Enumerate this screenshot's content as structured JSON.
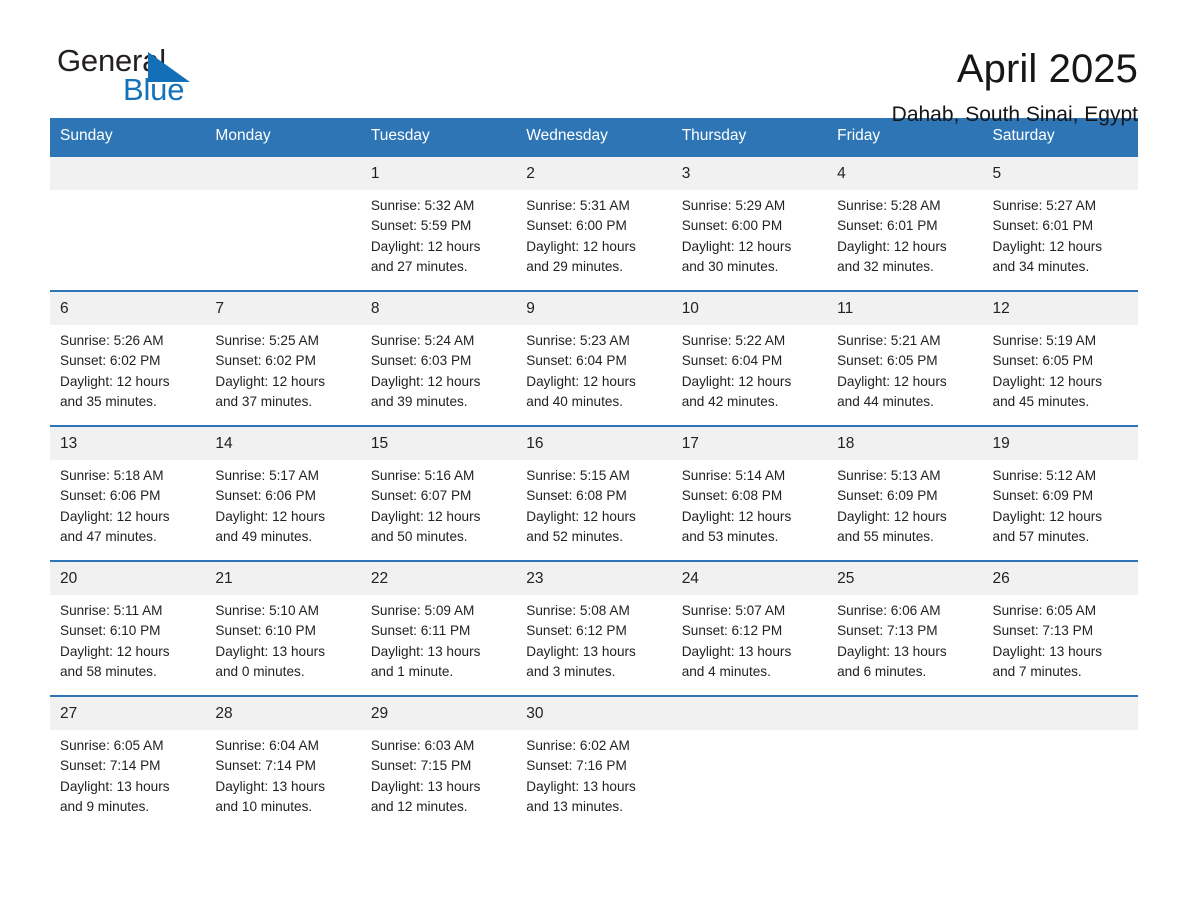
{
  "logo": {
    "word_top": "General",
    "word_bottom": "Blue",
    "triangle_icon": "triangle-icon"
  },
  "header": {
    "month_title": "April 2025",
    "location": "Dahab, South Sinai, Egypt"
  },
  "colors": {
    "brand_blue": "#2e75b6",
    "logo_blue": "#1571b8",
    "daynum_band": "#f1f1f1",
    "text": "#222222"
  },
  "calendar": {
    "weekday_headers": [
      "Sunday",
      "Monday",
      "Tuesday",
      "Wednesday",
      "Thursday",
      "Friday",
      "Saturday"
    ],
    "labels": {
      "sunrise": "Sunrise:",
      "sunset": "Sunset:",
      "daylight": "Daylight:"
    },
    "weeks": [
      [
        {
          "day": "",
          "empty": true
        },
        {
          "day": "",
          "empty": true
        },
        {
          "day": "1",
          "sunrise": "Sunrise: 5:32 AM",
          "sunset": "Sunset: 5:59 PM",
          "daylight_1": "Daylight: 12 hours",
          "daylight_2": "and 27 minutes."
        },
        {
          "day": "2",
          "sunrise": "Sunrise: 5:31 AM",
          "sunset": "Sunset: 6:00 PM",
          "daylight_1": "Daylight: 12 hours",
          "daylight_2": "and 29 minutes."
        },
        {
          "day": "3",
          "sunrise": "Sunrise: 5:29 AM",
          "sunset": "Sunset: 6:00 PM",
          "daylight_1": "Daylight: 12 hours",
          "daylight_2": "and 30 minutes."
        },
        {
          "day": "4",
          "sunrise": "Sunrise: 5:28 AM",
          "sunset": "Sunset: 6:01 PM",
          "daylight_1": "Daylight: 12 hours",
          "daylight_2": "and 32 minutes."
        },
        {
          "day": "5",
          "sunrise": "Sunrise: 5:27 AM",
          "sunset": "Sunset: 6:01 PM",
          "daylight_1": "Daylight: 12 hours",
          "daylight_2": "and 34 minutes."
        }
      ],
      [
        {
          "day": "6",
          "sunrise": "Sunrise: 5:26 AM",
          "sunset": "Sunset: 6:02 PM",
          "daylight_1": "Daylight: 12 hours",
          "daylight_2": "and 35 minutes."
        },
        {
          "day": "7",
          "sunrise": "Sunrise: 5:25 AM",
          "sunset": "Sunset: 6:02 PM",
          "daylight_1": "Daylight: 12 hours",
          "daylight_2": "and 37 minutes."
        },
        {
          "day": "8",
          "sunrise": "Sunrise: 5:24 AM",
          "sunset": "Sunset: 6:03 PM",
          "daylight_1": "Daylight: 12 hours",
          "daylight_2": "and 39 minutes."
        },
        {
          "day": "9",
          "sunrise": "Sunrise: 5:23 AM",
          "sunset": "Sunset: 6:04 PM",
          "daylight_1": "Daylight: 12 hours",
          "daylight_2": "and 40 minutes."
        },
        {
          "day": "10",
          "sunrise": "Sunrise: 5:22 AM",
          "sunset": "Sunset: 6:04 PM",
          "daylight_1": "Daylight: 12 hours",
          "daylight_2": "and 42 minutes."
        },
        {
          "day": "11",
          "sunrise": "Sunrise: 5:21 AM",
          "sunset": "Sunset: 6:05 PM",
          "daylight_1": "Daylight: 12 hours",
          "daylight_2": "and 44 minutes."
        },
        {
          "day": "12",
          "sunrise": "Sunrise: 5:19 AM",
          "sunset": "Sunset: 6:05 PM",
          "daylight_1": "Daylight: 12 hours",
          "daylight_2": "and 45 minutes."
        }
      ],
      [
        {
          "day": "13",
          "sunrise": "Sunrise: 5:18 AM",
          "sunset": "Sunset: 6:06 PM",
          "daylight_1": "Daylight: 12 hours",
          "daylight_2": "and 47 minutes."
        },
        {
          "day": "14",
          "sunrise": "Sunrise: 5:17 AM",
          "sunset": "Sunset: 6:06 PM",
          "daylight_1": "Daylight: 12 hours",
          "daylight_2": "and 49 minutes."
        },
        {
          "day": "15",
          "sunrise": "Sunrise: 5:16 AM",
          "sunset": "Sunset: 6:07 PM",
          "daylight_1": "Daylight: 12 hours",
          "daylight_2": "and 50 minutes."
        },
        {
          "day": "16",
          "sunrise": "Sunrise: 5:15 AM",
          "sunset": "Sunset: 6:08 PM",
          "daylight_1": "Daylight: 12 hours",
          "daylight_2": "and 52 minutes."
        },
        {
          "day": "17",
          "sunrise": "Sunrise: 5:14 AM",
          "sunset": "Sunset: 6:08 PM",
          "daylight_1": "Daylight: 12 hours",
          "daylight_2": "and 53 minutes."
        },
        {
          "day": "18",
          "sunrise": "Sunrise: 5:13 AM",
          "sunset": "Sunset: 6:09 PM",
          "daylight_1": "Daylight: 12 hours",
          "daylight_2": "and 55 minutes."
        },
        {
          "day": "19",
          "sunrise": "Sunrise: 5:12 AM",
          "sunset": "Sunset: 6:09 PM",
          "daylight_1": "Daylight: 12 hours",
          "daylight_2": "and 57 minutes."
        }
      ],
      [
        {
          "day": "20",
          "sunrise": "Sunrise: 5:11 AM",
          "sunset": "Sunset: 6:10 PM",
          "daylight_1": "Daylight: 12 hours",
          "daylight_2": "and 58 minutes."
        },
        {
          "day": "21",
          "sunrise": "Sunrise: 5:10 AM",
          "sunset": "Sunset: 6:10 PM",
          "daylight_1": "Daylight: 13 hours",
          "daylight_2": "and 0 minutes."
        },
        {
          "day": "22",
          "sunrise": "Sunrise: 5:09 AM",
          "sunset": "Sunset: 6:11 PM",
          "daylight_1": "Daylight: 13 hours",
          "daylight_2": "and 1 minute."
        },
        {
          "day": "23",
          "sunrise": "Sunrise: 5:08 AM",
          "sunset": "Sunset: 6:12 PM",
          "daylight_1": "Daylight: 13 hours",
          "daylight_2": "and 3 minutes."
        },
        {
          "day": "24",
          "sunrise": "Sunrise: 5:07 AM",
          "sunset": "Sunset: 6:12 PM",
          "daylight_1": "Daylight: 13 hours",
          "daylight_2": "and 4 minutes."
        },
        {
          "day": "25",
          "sunrise": "Sunrise: 6:06 AM",
          "sunset": "Sunset: 7:13 PM",
          "daylight_1": "Daylight: 13 hours",
          "daylight_2": "and 6 minutes."
        },
        {
          "day": "26",
          "sunrise": "Sunrise: 6:05 AM",
          "sunset": "Sunset: 7:13 PM",
          "daylight_1": "Daylight: 13 hours",
          "daylight_2": "and 7 minutes."
        }
      ],
      [
        {
          "day": "27",
          "sunrise": "Sunrise: 6:05 AM",
          "sunset": "Sunset: 7:14 PM",
          "daylight_1": "Daylight: 13 hours",
          "daylight_2": "and 9 minutes."
        },
        {
          "day": "28",
          "sunrise": "Sunrise: 6:04 AM",
          "sunset": "Sunset: 7:14 PM",
          "daylight_1": "Daylight: 13 hours",
          "daylight_2": "and 10 minutes."
        },
        {
          "day": "29",
          "sunrise": "Sunrise: 6:03 AM",
          "sunset": "Sunset: 7:15 PM",
          "daylight_1": "Daylight: 13 hours",
          "daylight_2": "and 12 minutes."
        },
        {
          "day": "30",
          "sunrise": "Sunrise: 6:02 AM",
          "sunset": "Sunset: 7:16 PM",
          "daylight_1": "Daylight: 13 hours",
          "daylight_2": "and 13 minutes."
        },
        {
          "day": "",
          "empty": true
        },
        {
          "day": "",
          "empty": true
        },
        {
          "day": "",
          "empty": true
        }
      ]
    ]
  }
}
